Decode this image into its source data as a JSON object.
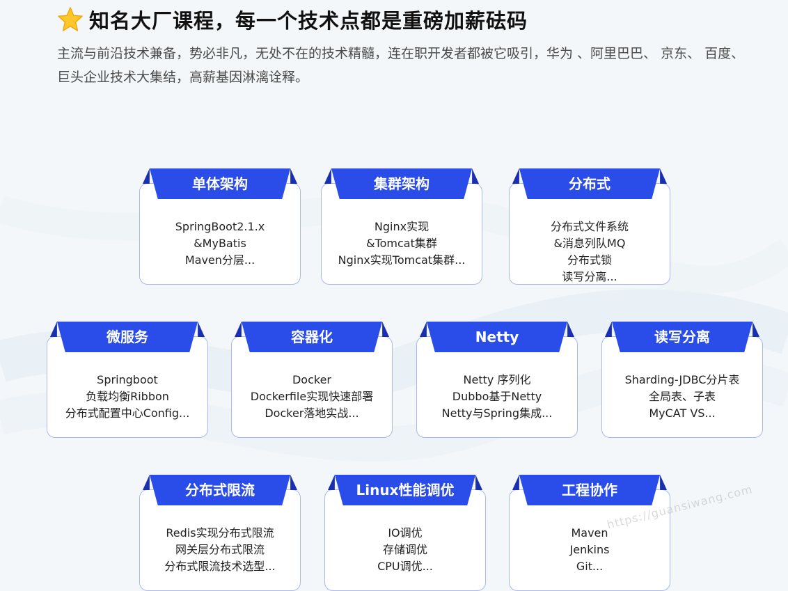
{
  "header": {
    "title": "知名大厂课程，每一个技术点都是重磅加薪砝码",
    "subtitle": "主流与前沿技术兼备，势必非凡，无处不在的技术精髓，连在职开发者都被它吸引，华为 、阿里巴巴、 京东、 百度、 巨头企业技术大集结，高薪基因淋漓诠释。",
    "title_icon": "star-icon"
  },
  "colors": {
    "accent": "#2a4dea",
    "accent_dark": "#1a2fb0",
    "card_border": "#a9b9ee"
  },
  "cards": [
    {
      "title": "单体架构",
      "lines": [
        "SpringBoot2.1.x",
        "&MyBatis",
        "Maven分层..."
      ]
    },
    {
      "title": "集群架构",
      "lines": [
        "Nginx实现",
        "&Tomcat集群",
        "Nginx实现Tomcat集群..."
      ]
    },
    {
      "title": "分布式",
      "lines": [
        "分布式文件系统",
        "&消息列队MQ",
        "分布式锁",
        "读写分离..."
      ]
    },
    {
      "title": "微服务",
      "lines": [
        "Springboot",
        "负载均衡Ribbon",
        "分布式配置中心Config..."
      ]
    },
    {
      "title": "容器化",
      "lines": [
        "Docker",
        "Dockerfile实现快速部署",
        "Docker落地实战..."
      ]
    },
    {
      "title": "Netty",
      "lines": [
        "Netty 序列化",
        "Dubbo基于Netty",
        "Netty与Spring集成..."
      ]
    },
    {
      "title": "读写分离",
      "lines": [
        "Sharding-JDBC分片表",
        "全局表、子表",
        "MyCAT VS..."
      ]
    },
    {
      "title": "分布式限流",
      "lines": [
        "Redis实现分布式限流",
        "网关层分布式限流",
        "分布式限流技术选型..."
      ]
    },
    {
      "title": "Linux性能调优",
      "lines": [
        "IO调优",
        "存储调优",
        "CPU调优..."
      ]
    },
    {
      "title": "工程协作",
      "lines": [
        "Maven",
        "Jenkins",
        "Git..."
      ]
    }
  ],
  "watermark": "https://guansiwang.com"
}
